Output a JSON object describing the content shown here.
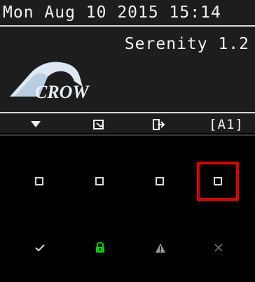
{
  "header": {
    "datetime": "Mon Aug 10 2015 15:14",
    "version": "Serenity 1.2",
    "logo_text": "CROW",
    "logo_icon": "crow-roof-logo"
  },
  "toolbar": {
    "menu_icon": "triangle-down-icon",
    "edit_icon": "edit-box-icon",
    "exit_icon": "exit-arrow-icon",
    "area_label": "[A1]"
  },
  "zones": {
    "items": [
      {
        "icon": "zone-square-icon",
        "selected": false
      },
      {
        "icon": "zone-square-icon",
        "selected": false
      },
      {
        "icon": "zone-square-icon",
        "selected": false
      },
      {
        "icon": "zone-square-icon",
        "selected": true
      }
    ],
    "selection_color": "#e00000"
  },
  "status_bar": {
    "items": [
      {
        "icon": "check-icon",
        "color": "#d9d9d9"
      },
      {
        "icon": "lock-icon",
        "color": "#00d000"
      },
      {
        "icon": "warning-icon",
        "color": "#9a9a9a"
      },
      {
        "icon": "cross-icon",
        "color": "#6a6a6a"
      }
    ]
  }
}
